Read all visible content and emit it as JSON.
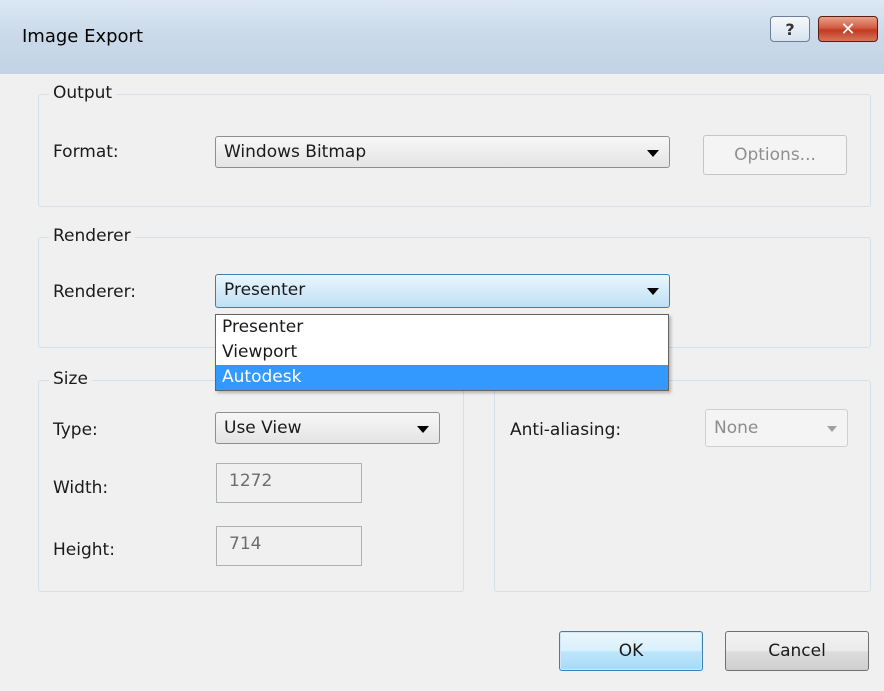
{
  "window": {
    "title": "Image Export"
  },
  "titlebar": {
    "help_label": "?",
    "close_label": "✕"
  },
  "output": {
    "legend": "Output",
    "format_label": "Format:",
    "format_value": "Windows Bitmap",
    "options_label": "Options..."
  },
  "renderer": {
    "legend": "Renderer",
    "renderer_label": "Renderer:",
    "renderer_value": "Presenter",
    "options": [
      "Presenter",
      "Viewport",
      "Autodesk"
    ],
    "highlighted_option": "Autodesk"
  },
  "size": {
    "legend": "Size",
    "type_label": "Type:",
    "type_value": "Use View",
    "width_label": "Width:",
    "width_value": "1272",
    "height_label": "Height:",
    "height_value": "714"
  },
  "antialias": {
    "label": "Anti-aliasing:",
    "value": "None"
  },
  "footer": {
    "ok_label": "OK",
    "cancel_label": "Cancel"
  }
}
